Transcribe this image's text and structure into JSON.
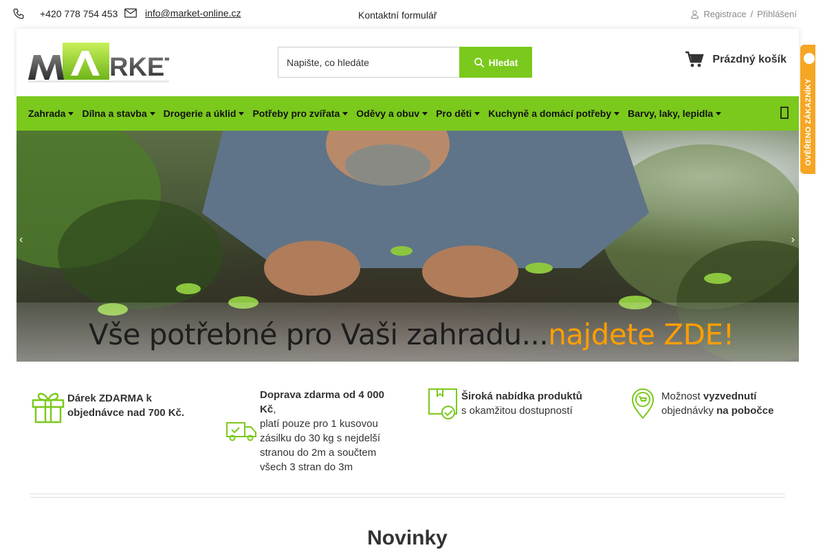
{
  "topbar": {
    "phone": "+420 778 754 453",
    "email": "info@market-online.cz",
    "contact": "Kontaktní formulář",
    "register": "Registrace",
    "separator": "/",
    "login": "Přihlášení"
  },
  "header": {
    "search_placeholder": "Napište, co hledáte",
    "search_button": "Hledat",
    "cart_label": "Prázdný košík"
  },
  "logo": {
    "text": "MARKET"
  },
  "nav": {
    "items": [
      "Zahrada",
      "Dílna a stavba",
      "Drogerie a úklid",
      "Potřeby pro zvířata",
      "Oděvy a obuv",
      "Pro děti",
      "Kuchyně a domácí potřeby",
      "Barvy, laky, lepidla"
    ]
  },
  "banner": {
    "caption_main": "Vše potřebné pro Vaši zahradu...",
    "caption_highlight": "najdete ZDE!"
  },
  "badge": {
    "text": "OVĚŘENO ZÁKAZNÍKY"
  },
  "features": {
    "gift": {
      "bold": "Dárek ZDARMA k objednávce nad 700 Kč."
    },
    "shipping": {
      "bold": "Doprava zdarma od 4 000 Kč",
      "comma": ",",
      "text": "platí pouze pro 1 kusovou zásilku do 30 kg s nejdelší stranou do 2m a součtem všech 3 stran do 3m"
    },
    "offer": {
      "bold": "Široká nabídka produktů",
      "text": "s okamžitou dostupností"
    },
    "pickup": {
      "pre": "Možnost ",
      "bold1": "vyzvednutí",
      "mid": "objednávky ",
      "bold2": "na pobočce"
    }
  },
  "section": {
    "title": "Novinky"
  },
  "colors": {
    "accent": "#7bc91c",
    "highlight": "#ff9e00",
    "badge": "#f5a623"
  }
}
